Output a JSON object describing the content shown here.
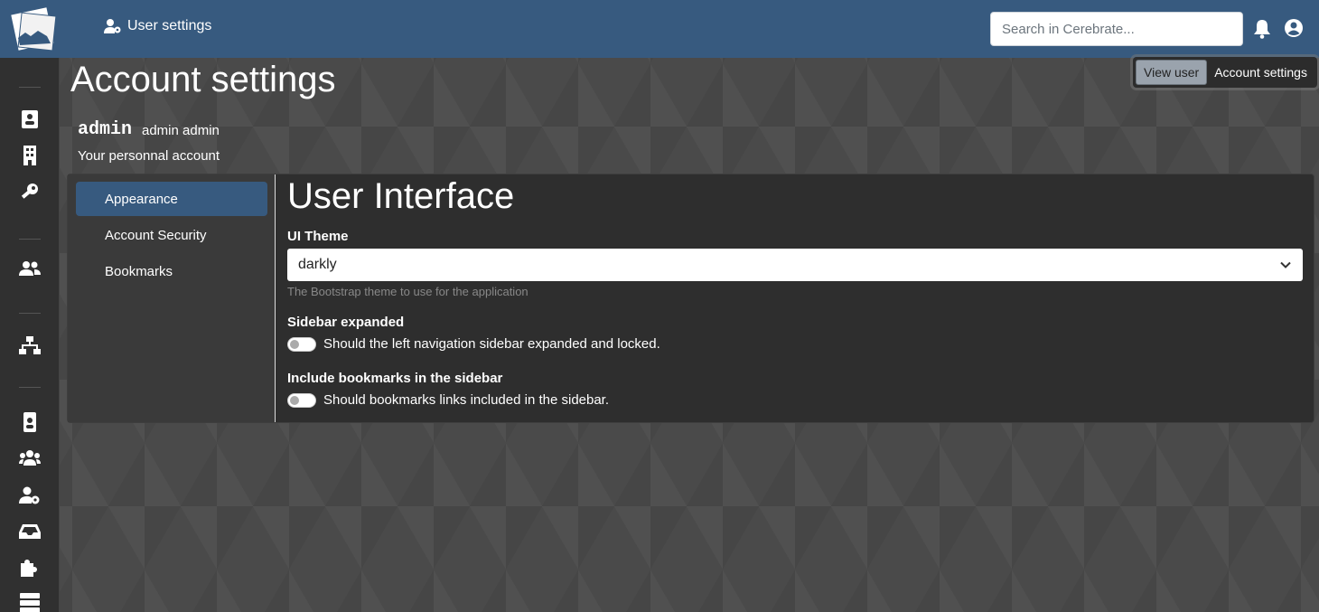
{
  "header": {
    "page_label": "User settings",
    "search_placeholder": "Search in Cerebrate..."
  },
  "page": {
    "title": "Account settings",
    "username": "admin",
    "full_name": "admin admin",
    "description": "Your personnal account"
  },
  "view_toggle": {
    "view_user": "View user",
    "account_settings": "Account settings",
    "active": "view_user"
  },
  "settings_nav": {
    "items": [
      {
        "label": "Appearance",
        "active": true
      },
      {
        "label": "Account Security",
        "active": false
      },
      {
        "label": "Bookmarks",
        "active": false
      }
    ]
  },
  "section": {
    "title": "User Interface",
    "ui_theme": {
      "label": "UI Theme",
      "value": "darkly",
      "help": "The Bootstrap theme to use for the application"
    },
    "sidebar_expanded": {
      "label": "Sidebar expanded",
      "description": "Should the left navigation sidebar expanded and locked.",
      "checked": false
    },
    "bookmarks_in_sidebar": {
      "label": "Include bookmarks in the sidebar",
      "description": "Should bookmarks links included in the sidebar.",
      "checked": false
    }
  },
  "sidebar_icons": [
    "address-card-icon",
    "building-icon",
    "key-icon",
    "users-icon",
    "network-icon",
    "id-badge-icon",
    "user-group-icon",
    "user-cog-icon",
    "inbox-icon",
    "puzzle-icon",
    "server-icon"
  ],
  "colors": {
    "navbar": "#375a7f",
    "sidebar": "#303030",
    "card": "#2e2e2e",
    "active_nav": "#375a7f"
  }
}
